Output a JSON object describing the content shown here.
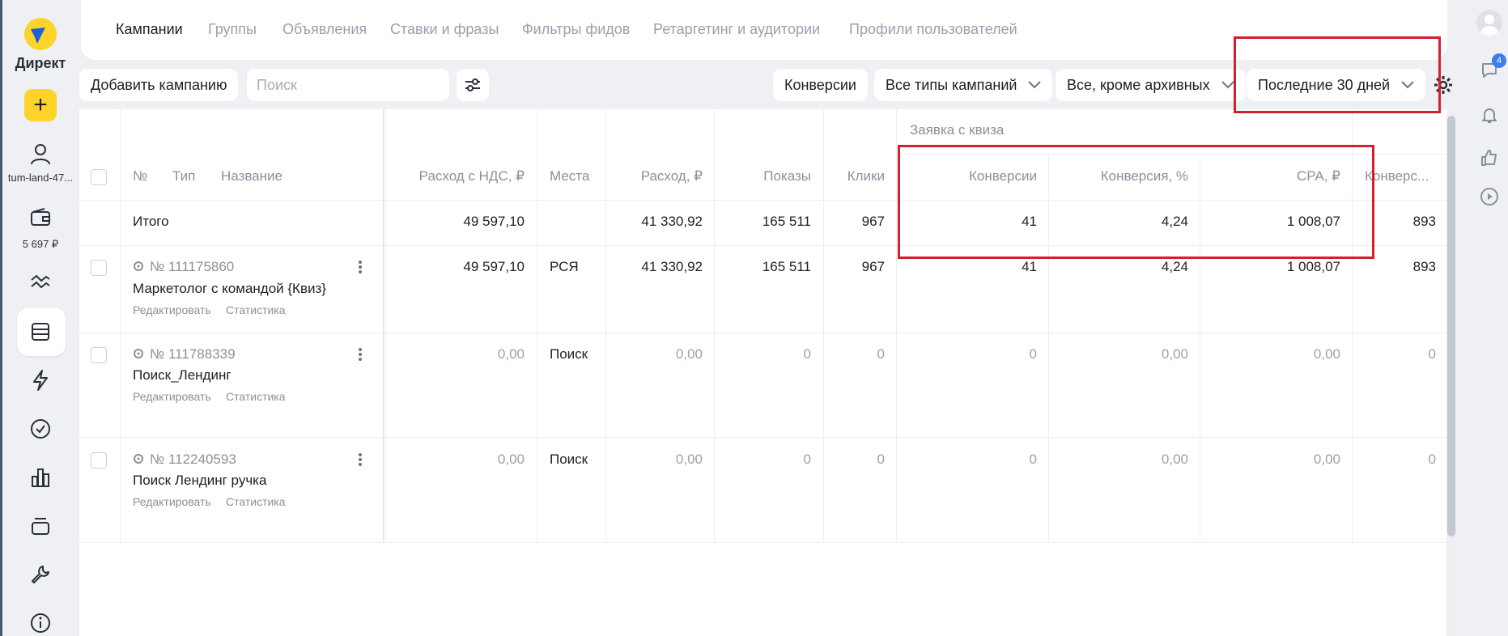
{
  "sidebar": {
    "brand": "Директ",
    "account": "tum-land-47...",
    "balance": "5 697 ₽"
  },
  "rail": {
    "badge": "4"
  },
  "tabs": [
    {
      "label": "Кампании",
      "active": true
    },
    {
      "label": "Группы"
    },
    {
      "label": "Объявления"
    },
    {
      "label": "Ставки и фразы"
    },
    {
      "label": "Фильтры фидов"
    },
    {
      "label": "Ретаргетинг и аудитории"
    },
    {
      "label": "Профили пользователей"
    }
  ],
  "toolbar": {
    "add_campaign": "Добавить кампанию",
    "search_placeholder": "Поиск",
    "conversions": "Конверсии",
    "campaign_types": "Все типы кампаний",
    "status_filter": "Все, кроме архивных",
    "period": "Последние 30 дней"
  },
  "table": {
    "group_header": "Заявка с квиза",
    "headers": {
      "num": "№",
      "type": "Тип",
      "name": "Название",
      "spend_vat": "Расход с НДС, ₽",
      "places": "Места",
      "spend": "Расход, ₽",
      "impressions": "Показы",
      "clicks": "Клики",
      "conversions": "Конверсии",
      "conv_rate": "Конверсия, %",
      "cpa": "CPA, ₽",
      "conv_more": "Конверс..."
    },
    "total": {
      "label": "Итого",
      "spend_vat": "49 597,10",
      "places": "",
      "spend": "41 330,92",
      "impressions": "165 511",
      "clicks": "967",
      "conversions": "41",
      "conv_rate": "4,24",
      "cpa": "1 008,07",
      "conv_more": "893"
    },
    "rows": [
      {
        "id": "№ 111175860",
        "name": "Маркетолог с командой {Квиз}",
        "edit": "Редактировать",
        "stats": "Статистика",
        "spend_vat": "49 597,10",
        "places": "РСЯ",
        "spend": "41 330,92",
        "impressions": "165 511",
        "clicks": "967",
        "conversions": "41",
        "conv_rate": "4,24",
        "cpa": "1 008,07",
        "conv_more": "893"
      },
      {
        "id": "№ 111788339",
        "name": "Поиск_Лендинг",
        "edit": "Редактировать",
        "stats": "Статистика",
        "spend_vat": "0,00",
        "places": "Поиск",
        "spend": "0,00",
        "impressions": "0",
        "clicks": "0",
        "conversions": "0",
        "conv_rate": "0,00",
        "cpa": "0,00",
        "conv_more": "0"
      },
      {
        "id": "№ 112240593",
        "name": "Поиск Лендинг ручка",
        "edit": "Редактировать",
        "stats": "Статистика",
        "spend_vat": "0,00",
        "places": "Поиск",
        "spend": "0,00",
        "impressions": "0",
        "clicks": "0",
        "conversions": "0",
        "conv_rate": "0,00",
        "cpa": "0,00",
        "conv_more": "0"
      }
    ]
  },
  "colors": {
    "accent_yellow": "#fed42b",
    "highlight_red": "#d3202a",
    "badge_blue": "#3c7ef0",
    "background": "#eef0f4"
  }
}
